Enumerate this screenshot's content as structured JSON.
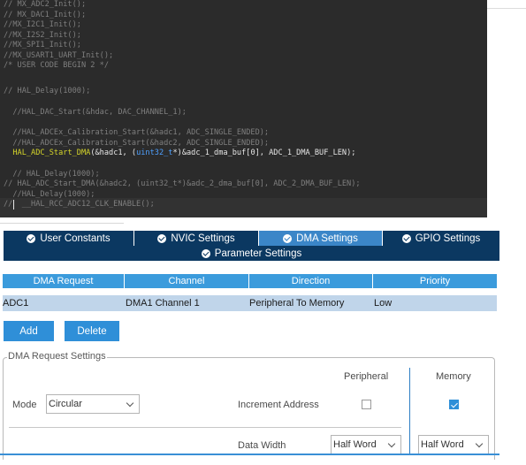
{
  "colors": {
    "editor_bg": "#2b2b2b",
    "tab_bg": "#0b3861",
    "tab_active_bg": "#3b86c8",
    "table_header_bg": "#3b9bdc",
    "selected_row_bg": "#c0d5ea",
    "button_bg": "#2f8fd8"
  },
  "code": {
    "lines": [
      "// MX_ADC2_Init();",
      "// MX_DAC1_Init();",
      "//MX_I2C1_Init();",
      "//MX_I2S2_Init();",
      "//MX_SPI1_Init();",
      "//MX_USART1_UART_Init();",
      "/* USER CODE BEGIN 2 */",
      "",
      "// HAL_Delay(1000);",
      "",
      "  //HAL_DAC_Start(&hdac, DAC_CHANNEL_1);",
      "",
      "  //HAL_ADCEx_Calibration_Start(&hadc1, ADC_SINGLE_ENDED);",
      "  //HAL_ADCEx_Calibration_Start(&hadc2, ADC_SINGLE_ENDED);",
      "",
      "",
      "  // HAL_Delay(1000);",
      "// HAL_ADC_Start_DMA(&hadc2, (uint32_t*)&adc_2_dma_buf[0], ADC_2_DMA_BUF_LEN);",
      "  //HAL_Delay(1000);",
      "//  __HAL_RCC_ADC12_CLK_ENABLE();"
    ],
    "active_func": "HAL_ADC_Start_DMA",
    "active_a": "(&hadc1, (",
    "active_type": "uint32_t",
    "active_b": "*)&adc_1_dma_buf[0], ADC_1_DMA_BUF_LEN);"
  },
  "tabs": [
    {
      "label": "User Constants",
      "icon": "check-circle-icon"
    },
    {
      "label": "NVIC Settings",
      "icon": "check-circle-icon"
    },
    {
      "label": "DMA Settings",
      "icon": "check-circle-icon",
      "active": true
    },
    {
      "label": "GPIO Settings",
      "icon": "check-circle-icon"
    }
  ],
  "param_tab": {
    "label": "Parameter Settings",
    "icon": "check-circle-icon"
  },
  "dma_table": {
    "headers": [
      "DMA Request",
      "Channel",
      "Direction",
      "Priority"
    ],
    "rows": [
      [
        "ADC1",
        "DMA1 Channel 1",
        "Peripheral To Memory",
        "Low"
      ]
    ]
  },
  "buttons": {
    "add": "Add",
    "delete": "Delete"
  },
  "request_settings": {
    "title": "DMA Request Settings",
    "peripheral_header": "Peripheral",
    "memory_header": "Memory",
    "mode_label": "Mode",
    "mode_value": "Circular",
    "increment_label": "Increment Address",
    "increment_peripheral": false,
    "increment_memory": true,
    "data_width_label": "Data Width",
    "peripheral_width": "Half Word",
    "memory_width": "Half Word"
  }
}
